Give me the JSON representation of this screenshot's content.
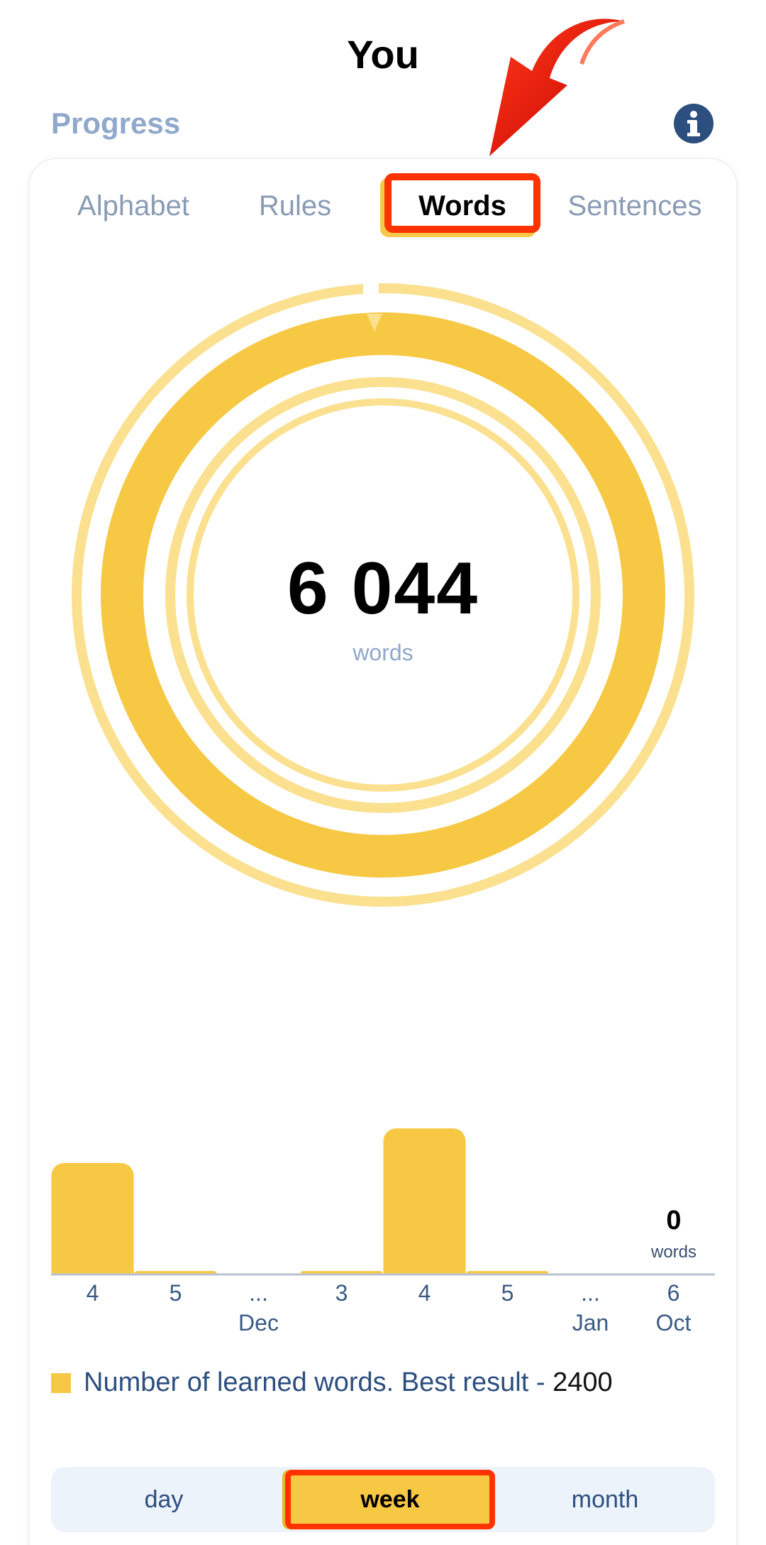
{
  "header": {
    "title": "You"
  },
  "progress": {
    "title": "Progress"
  },
  "tabs": [
    {
      "label": "Alphabet"
    },
    {
      "label": "Rules"
    },
    {
      "label": "Words"
    },
    {
      "label": "Sentences"
    }
  ],
  "summary": {
    "total": "6 044",
    "unit": "words"
  },
  "chart_data": {
    "type": "bar",
    "categories": [
      "4",
      "5",
      "...",
      "3",
      "4",
      "5",
      "...",
      "6"
    ],
    "month_labels": [
      "",
      "",
      "Dec",
      "",
      "",
      "",
      "Jan",
      "Oct"
    ],
    "values": [
      1600,
      40,
      0,
      40,
      2100,
      40,
      0,
      0
    ],
    "ylim": [
      0,
      2400
    ],
    "selected_index": 7,
    "selected_value": "0",
    "selected_unit": "words",
    "bar_color": "#f7c843"
  },
  "legend": {
    "text": "Number of learned words. Best result - ",
    "best": "2400"
  },
  "periods": [
    {
      "label": "day"
    },
    {
      "label": "week"
    },
    {
      "label": "month"
    }
  ],
  "colors": {
    "accent": "#f7c843",
    "highlight": "#ff3300",
    "title_blue": "#8fa8cc",
    "dark_blue": "#2c4f7f"
  }
}
